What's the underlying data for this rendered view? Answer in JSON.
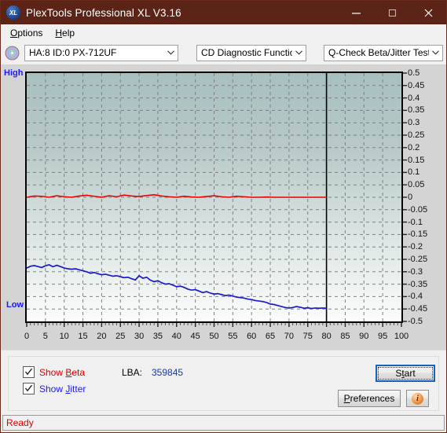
{
  "window": {
    "title": "PlexTools Professional XL V3.16",
    "logo_text": "XL",
    "minimize_label": "minimize",
    "maximize_label": "maximize",
    "close_label": "close",
    "titlebar_color": "#5c2417"
  },
  "menubar": {
    "items": [
      {
        "label": "Options",
        "accel": "O"
      },
      {
        "label": "Help",
        "accel": "H"
      }
    ]
  },
  "toolbar": {
    "drive_combo": {
      "value": "HA:8 ID:0  PX-712UF"
    },
    "function_combo": {
      "value": "CD Diagnostic Functions"
    },
    "test_combo": {
      "value": "Q-Check Beta/Jitter Test"
    }
  },
  "chart_data": {
    "type": "line",
    "title": "Q-Check Beta/Jitter Test",
    "xlabel": "",
    "ylabel": "",
    "xlim": [
      0,
      100
    ],
    "ylim": [
      -0.5,
      0.5
    ],
    "grid": true,
    "legend_position": "bottom-left",
    "axis_high_label": "High",
    "axis_low_label": "Low",
    "data_end_x": 80,
    "xticks": [
      0,
      5,
      10,
      15,
      20,
      25,
      30,
      35,
      40,
      45,
      50,
      55,
      60,
      65,
      70,
      75,
      80,
      85,
      90,
      95,
      100
    ],
    "yticks": [
      0.5,
      0.45,
      0.4,
      0.35,
      0.3,
      0.25,
      0.2,
      0.15,
      0.1,
      0.05,
      0,
      -0.05,
      -0.1,
      -0.15,
      -0.2,
      -0.25,
      -0.3,
      -0.35,
      -0.4,
      -0.45,
      -0.5
    ],
    "series": [
      {
        "name": "Beta",
        "color": "#ee0000",
        "x": [
          0,
          2,
          4,
          6,
          8,
          10,
          12,
          14,
          16,
          18,
          20,
          22,
          24,
          26,
          28,
          30,
          32,
          34,
          36,
          38,
          40,
          42,
          44,
          46,
          48,
          50,
          52,
          54,
          56,
          58,
          60,
          62,
          64,
          66,
          68,
          70,
          72,
          74,
          76,
          78,
          80
        ],
        "values": [
          0.0,
          0.005,
          0.004,
          0.0,
          0.006,
          0.002,
          0.0,
          0.005,
          0.008,
          0.004,
          0.0,
          0.006,
          0.002,
          0.009,
          0.005,
          0.003,
          0.007,
          0.01,
          0.005,
          0.002,
          0.0,
          0.004,
          0.001,
          0.0,
          0.003,
          0.006,
          0.002,
          0.0,
          0.004,
          0.002,
          0.0,
          0.0,
          0.001,
          0.0,
          0.0,
          0.0,
          0.0,
          0.0,
          0.0,
          0.0,
          0.0
        ]
      },
      {
        "name": "Jitter",
        "color": "#1a1ad0",
        "x": [
          0,
          1,
          2,
          3,
          4,
          5,
          6,
          7,
          8,
          9,
          10,
          11,
          12,
          13,
          14,
          15,
          16,
          17,
          18,
          19,
          20,
          21,
          22,
          23,
          24,
          25,
          26,
          27,
          28,
          29,
          30,
          31,
          32,
          33,
          34,
          35,
          36,
          37,
          38,
          39,
          40,
          41,
          42,
          43,
          44,
          45,
          46,
          47,
          48,
          49,
          50,
          51,
          52,
          53,
          54,
          55,
          56,
          57,
          58,
          59,
          60,
          61,
          62,
          63,
          64,
          65,
          66,
          67,
          68,
          69,
          70,
          71,
          72,
          73,
          74,
          75,
          76,
          77,
          78,
          79,
          80
        ],
        "values": [
          -0.285,
          -0.278,
          -0.275,
          -0.279,
          -0.283,
          -0.276,
          -0.272,
          -0.28,
          -0.274,
          -0.279,
          -0.285,
          -0.288,
          -0.29,
          -0.288,
          -0.292,
          -0.296,
          -0.3,
          -0.306,
          -0.303,
          -0.308,
          -0.312,
          -0.31,
          -0.314,
          -0.318,
          -0.316,
          -0.32,
          -0.324,
          -0.322,
          -0.328,
          -0.333,
          -0.316,
          -0.326,
          -0.322,
          -0.334,
          -0.34,
          -0.336,
          -0.344,
          -0.35,
          -0.348,
          -0.354,
          -0.36,
          -0.358,
          -0.363,
          -0.37,
          -0.374,
          -0.372,
          -0.378,
          -0.384,
          -0.38,
          -0.386,
          -0.39,
          -0.388,
          -0.392,
          -0.396,
          -0.394,
          -0.398,
          -0.402,
          -0.404,
          -0.406,
          -0.41,
          -0.412,
          -0.416,
          -0.418,
          -0.42,
          -0.424,
          -0.43,
          -0.432,
          -0.436,
          -0.44,
          -0.444,
          -0.446,
          -0.444,
          -0.44,
          -0.443,
          -0.447,
          -0.445,
          -0.448,
          -0.446,
          -0.447,
          -0.446,
          -0.447
        ]
      }
    ]
  },
  "controls": {
    "show_beta": {
      "label_a": "Show ",
      "accel": "B",
      "label_b": "eta",
      "checked": true,
      "color": "#e00000"
    },
    "show_jitter": {
      "label_a": "Show ",
      "accel": "J",
      "label_b": "itter",
      "checked": true,
      "color": "#1a1aff"
    },
    "lba_label": "LBA:",
    "lba_value": "359845",
    "start_button": {
      "label_a": "S",
      "accel": "t",
      "label_b": "art",
      "full": "Start"
    },
    "preferences_button": {
      "accel": "P",
      "label_b": "references",
      "full": "Preferences"
    },
    "info_button": {
      "glyph": "i",
      "label": "Info"
    }
  },
  "statusbar": {
    "text": "Ready",
    "color": "#e00000"
  }
}
